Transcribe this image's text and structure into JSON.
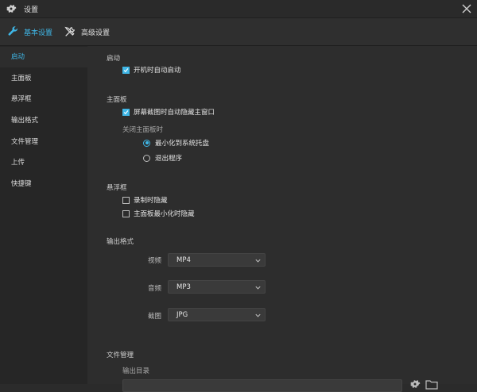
{
  "window": {
    "title": "设置"
  },
  "tabs": [
    {
      "label": "基本设置",
      "active": true
    },
    {
      "label": "高级设置",
      "active": false
    }
  ],
  "sidebar": {
    "items": [
      {
        "label": "启动",
        "active": true
      },
      {
        "label": "主面板"
      },
      {
        "label": "悬浮框"
      },
      {
        "label": "输出格式"
      },
      {
        "label": "文件管理"
      },
      {
        "label": "上传"
      },
      {
        "label": "快捷键"
      }
    ]
  },
  "sections": {
    "startup": {
      "title": "启动",
      "auto_start": {
        "label": "开机时自动启动",
        "checked": true
      }
    },
    "main_panel": {
      "title": "主面板",
      "hide_on_capture": {
        "label": "屏幕截图时自动隐藏主窗口",
        "checked": true
      },
      "close_title": "关闭主面板时",
      "radio_minimize": {
        "label": "最小化到系统托盘",
        "selected": true
      },
      "radio_exit": {
        "label": "退出程序",
        "selected": false
      }
    },
    "float": {
      "title": "悬浮框",
      "hide_recording": {
        "label": "录制时隐藏",
        "checked": false
      },
      "hide_min": {
        "label": "主面板最小化时隐藏",
        "checked": false
      }
    },
    "output": {
      "title": "输出格式",
      "video": {
        "label": "视频",
        "value": "MP4"
      },
      "audio": {
        "label": "音频",
        "value": "MP3"
      },
      "screenshot": {
        "label": "截图",
        "value": "JPG"
      }
    },
    "files": {
      "title": "文件管理",
      "output_dir_label": "输出目录"
    }
  },
  "colors": {
    "accent": "#3fb6e6",
    "background": "#2d2d2d",
    "sidebar": "#262626"
  }
}
